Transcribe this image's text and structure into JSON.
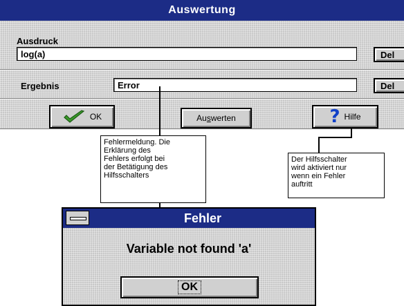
{
  "main_window": {
    "title": "Auswertung",
    "expression_label": "Ausdruck",
    "expression_value": "log(a)",
    "result_label": "Ergebnis",
    "result_value": "Error",
    "del_label": "Del",
    "ok_label": "OK",
    "evaluate_label_pre": "Au",
    "evaluate_label_mn": "s",
    "evaluate_label_post": "werten",
    "help_label": "Hilfe"
  },
  "annotations": {
    "error_note": [
      "Fehlermeldung. Die",
      "Erklärung des",
      "Fehlers erfolgt bei",
      "der Betätigung des",
      "Hilfsschalters"
    ],
    "help_note": [
      "Der Hilfsschalter",
      "wird aktiviert nur",
      "wenn ein Fehler",
      "auftritt"
    ]
  },
  "error_dialog": {
    "title": "Fehler",
    "message": "Variable not found 'a'",
    "ok_label": "OK"
  },
  "colors": {
    "title_bar": "#1c2c86",
    "check_icon": "#3a9a2a",
    "help_icon": "#1040c8"
  }
}
